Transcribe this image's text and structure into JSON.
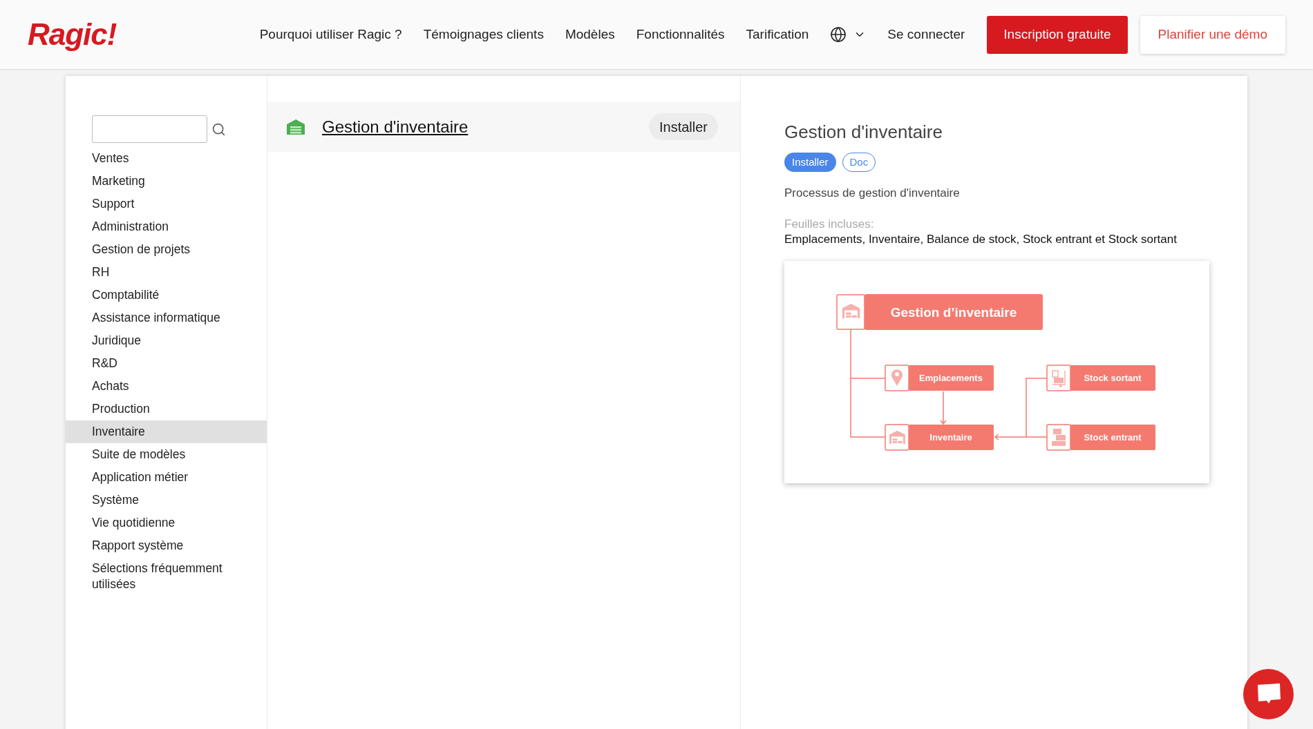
{
  "header": {
    "logo": "Ragic!",
    "nav": [
      "Pourquoi utiliser Ragic ?",
      "Témoignages clients",
      "Modèles",
      "Fonctionnalités",
      "Tarification"
    ],
    "login": "Se connecter",
    "signup_button": "Inscription gratuite",
    "demo_button": "Planifier une démo"
  },
  "sidebar": {
    "categories": [
      {
        "label": "Ventes",
        "selected": false
      },
      {
        "label": "Marketing",
        "selected": false
      },
      {
        "label": "Support",
        "selected": false
      },
      {
        "label": "Administration",
        "selected": false
      },
      {
        "label": "Gestion de projets",
        "selected": false
      },
      {
        "label": "RH",
        "selected": false
      },
      {
        "label": "Comptabilité",
        "selected": false
      },
      {
        "label": "Assistance informatique",
        "selected": false
      },
      {
        "label": "Juridique",
        "selected": false
      },
      {
        "label": "R&D",
        "selected": false
      },
      {
        "label": "Achats",
        "selected": false
      },
      {
        "label": "Production",
        "selected": false
      },
      {
        "label": "Inventaire",
        "selected": true
      },
      {
        "label": "Suite de modèles",
        "selected": false
      },
      {
        "label": "Application métier",
        "selected": false
      },
      {
        "label": "Système",
        "selected": false
      },
      {
        "label": "Vie quotidienne",
        "selected": false
      },
      {
        "label": "Rapport système",
        "selected": false
      },
      {
        "label": "Sélections fréquemment utilisées",
        "selected": false
      }
    ]
  },
  "templates": [
    {
      "title": "Gestion d'inventaire",
      "install_button": "Installer"
    }
  ],
  "detail": {
    "title": "Gestion d'inventaire",
    "install_button": "Installer",
    "doc_button": "Doc",
    "description": "Processus de gestion d'inventaire",
    "sheets_label": "Feuilles incluses:",
    "sheets": "Emplacements, Inventaire, Balance de stock, Stock entrant et Stock sortant",
    "diagram": {
      "title": "Gestion d’inventaire",
      "nodes": [
        "Emplacements",
        "Stock sortant",
        "Inventaire",
        "Stock entrant"
      ]
    }
  }
}
